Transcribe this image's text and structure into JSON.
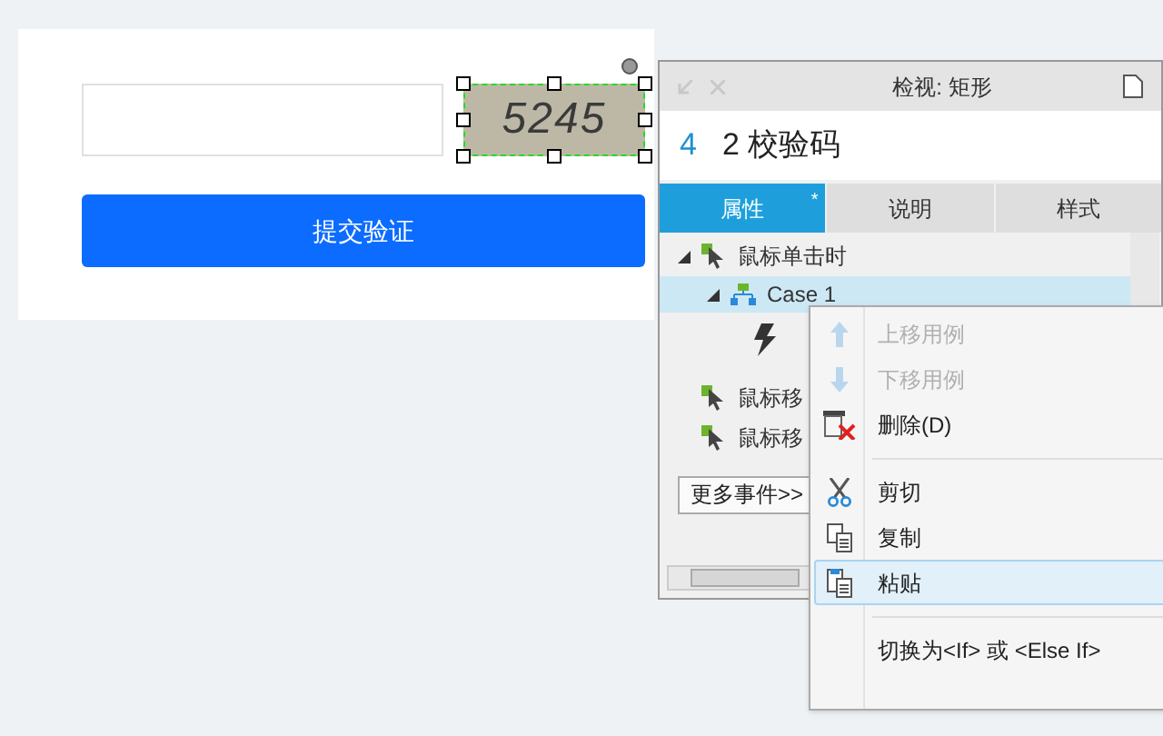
{
  "form": {
    "captcha": {
      "code": "5245",
      "selected": true
    },
    "submit": "提交验证"
  },
  "inspector": {
    "title": "检视: 矩形",
    "number": "4",
    "name": "2 校验码",
    "tabs": [
      {
        "label": "属性",
        "selected": true,
        "marker": "*"
      },
      {
        "label": "说明",
        "selected": false
      },
      {
        "label": "样式",
        "selected": false
      }
    ],
    "tree": [
      {
        "kind": "event",
        "label": "鼠标单击时",
        "expanded": true,
        "children": [
          {
            "kind": "case",
            "label": "Case 1",
            "selected": true,
            "expanded": true,
            "children": [
              {
                "kind": "action"
              }
            ]
          }
        ]
      },
      {
        "kind": "event",
        "label": "鼠标移"
      },
      {
        "kind": "event",
        "label": "鼠标移"
      }
    ],
    "more_events": "更多事件>>"
  },
  "context_menu": [
    {
      "kind": "up",
      "label": "上移用例",
      "disabled": true,
      "selected": false
    },
    {
      "kind": "down",
      "label": "下移用例",
      "disabled": true,
      "selected": false
    },
    {
      "kind": "delete",
      "label": "删除(D)",
      "disabled": false,
      "selected": false
    },
    {
      "kind": "separator"
    },
    {
      "kind": "cut",
      "label": "剪切",
      "disabled": false,
      "selected": false
    },
    {
      "kind": "copy",
      "label": "复制",
      "disabled": false,
      "selected": false
    },
    {
      "kind": "paste",
      "label": "粘贴",
      "disabled": false,
      "selected": true
    },
    {
      "kind": "separator"
    },
    {
      "kind": "text",
      "label": "切换为<If> 或 <Else If>",
      "disabled": false,
      "selected": false
    }
  ]
}
